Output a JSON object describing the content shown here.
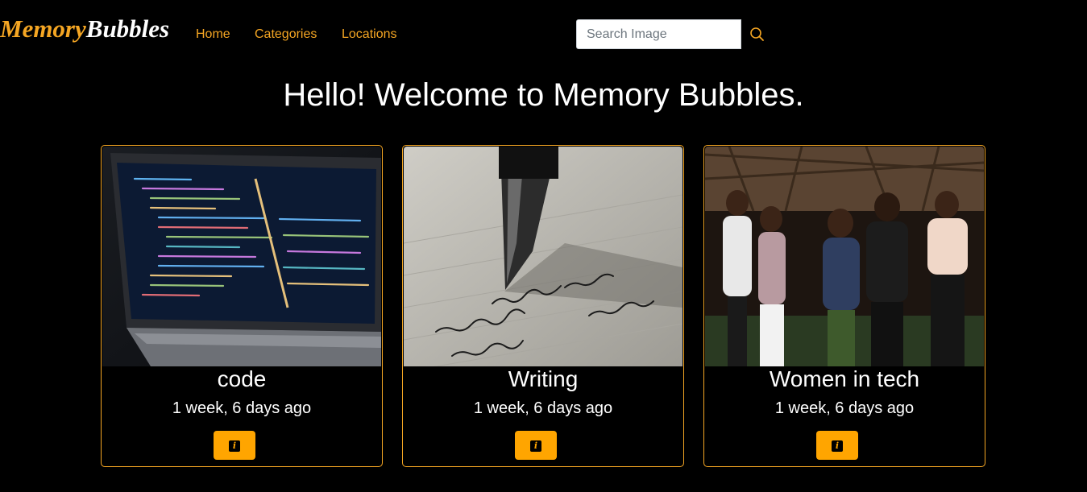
{
  "brand": {
    "part1": "Memory",
    "part2": "Bubbles"
  },
  "nav": {
    "items": [
      {
        "label": "Home"
      },
      {
        "label": "Categories"
      },
      {
        "label": "Locations"
      }
    ]
  },
  "search": {
    "placeholder": "Search Image",
    "value": ""
  },
  "welcome": {
    "heading": "Hello! Welcome to Memory Bubbles."
  },
  "cards": [
    {
      "title": "code",
      "time": "1 week, 6 days ago",
      "image_icon": "laptop-code-photo"
    },
    {
      "title": "Writing",
      "time": "1 week, 6 days ago",
      "image_icon": "fountain-pen-photo"
    },
    {
      "title": "Women in tech",
      "time": "1 week, 6 days ago",
      "image_icon": "group-photo"
    }
  ],
  "colors": {
    "accent": "#f5a623",
    "button": "#ffa500",
    "background": "#000000",
    "text": "#ffffff"
  }
}
